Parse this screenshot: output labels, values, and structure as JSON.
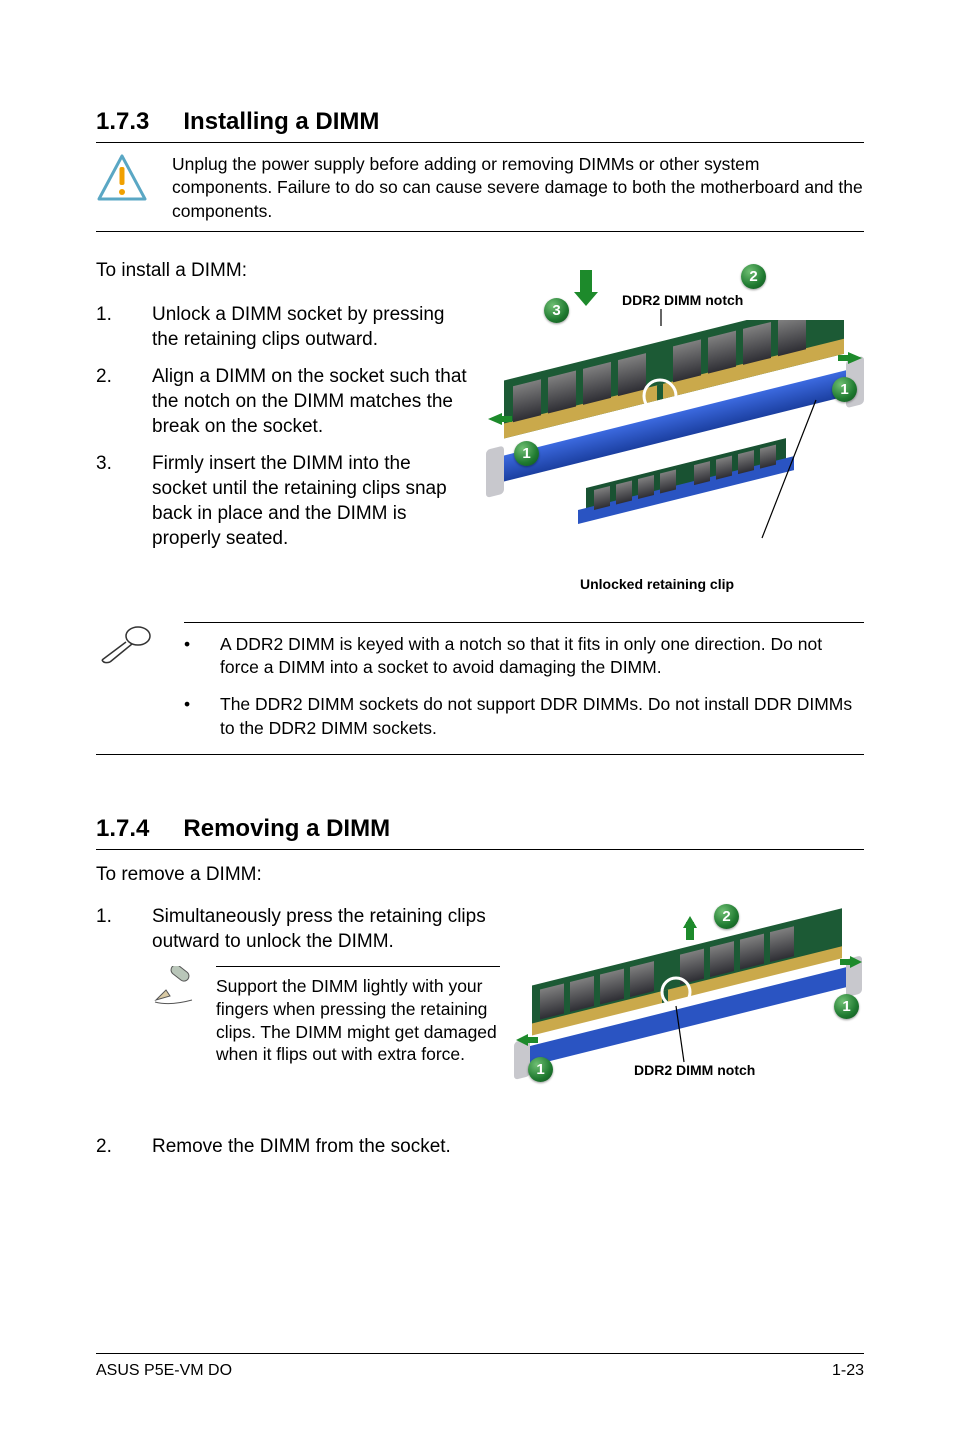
{
  "sec173": {
    "num": "1.7.3",
    "title": "Installing a DIMM"
  },
  "caution_text": "Unplug the power supply before adding or removing DIMMs or other system components. Failure to do so can cause severe damage to both the motherboard and the components.",
  "install": {
    "lead": "To install a DIMM:",
    "steps": [
      "Unlock a DIMM socket by pressing the retaining clips outward.",
      "Align a DIMM on the socket such that the notch on the DIMM matches the break on the socket.",
      "Firmly insert the DIMM into the socket until the retaining clips snap back in place and the DIMM is properly seated."
    ]
  },
  "fig1": {
    "notch": "DDR2 DIMM notch",
    "unlocked": "Unlocked retaining clip",
    "b1": "1",
    "b2": "2",
    "b3": "3",
    "b1b": "1"
  },
  "notes1": [
    "A DDR2 DIMM is keyed with a notch so that it fits in only one direction. Do not force a DIMM into a socket to avoid damaging the DIMM.",
    "The DDR2 DIMM sockets do not support DDR DIMMs. Do not install DDR DIMMs to the DDR2 DIMM sockets."
  ],
  "sec174": {
    "num": "1.7.4",
    "title": "Removing a DIMM"
  },
  "remove": {
    "lead": "To remove a DIMM:",
    "step1": "Simultaneously press the retaining clips outward to unlock the DIMM.",
    "tip": "Support the DIMM lightly with your fingers when pressing the retaining clips. The DIMM might get damaged when it flips out with extra force.",
    "step2": "Remove the DIMM from the socket."
  },
  "fig2": {
    "notch": "DDR2 DIMM notch",
    "b1": "1",
    "b1b": "1",
    "b2": "2"
  },
  "footer": {
    "left": "ASUS P5E-VM DO",
    "right": "1-23"
  }
}
